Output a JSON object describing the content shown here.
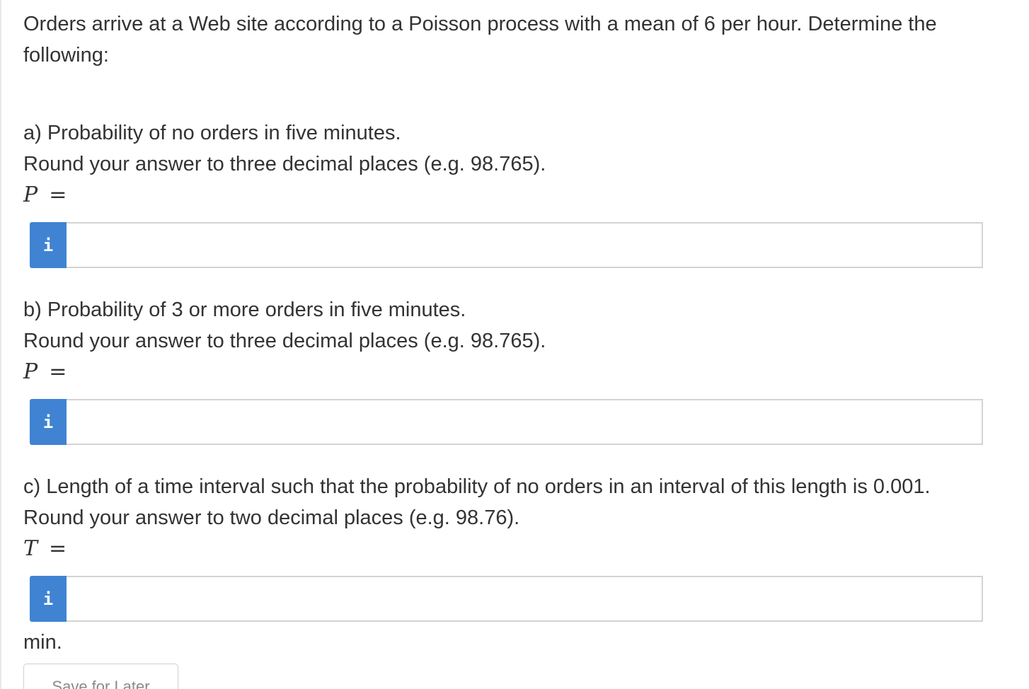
{
  "question": {
    "intro": "Orders arrive at a Web site according to a Poisson process with a mean of 6 per hour. Determine the following:"
  },
  "parts": [
    {
      "prompt": "a) Probability of no orders in five minutes.",
      "rounding": "Round your answer to three decimal places (e.g. 98.765).",
      "variable": "P",
      "equals": "=",
      "answer_value": "",
      "info_icon": "i"
    },
    {
      "prompt": "b) Probability of 3 or more orders in five minutes.",
      "rounding": "Round your answer to three decimal places (e.g. 98.765).",
      "variable": "P",
      "equals": "=",
      "answer_value": "",
      "info_icon": "i"
    },
    {
      "prompt": "c) Length of a time interval such that the probability of no orders in an interval of this length is 0.001.",
      "rounding": "Round your answer to two decimal places (e.g. 98.76).",
      "variable": "T",
      "equals": "=",
      "answer_value": "",
      "info_icon": "i",
      "unit": "min."
    }
  ],
  "actions": {
    "save_label": "Save for Later"
  },
  "colors": {
    "info_button": "#3f83d2",
    "text": "#333333",
    "input_border": "#d3d3d3"
  },
  "icons": {
    "info": "info-icon"
  }
}
